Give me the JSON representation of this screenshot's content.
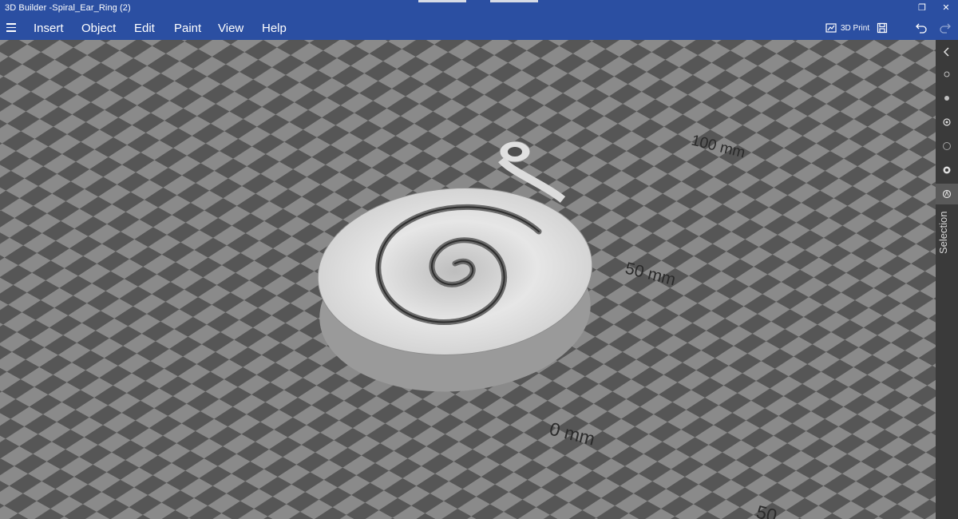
{
  "window": {
    "title": "3D Builder -Spiral_Ear_Ring (2)",
    "restore_glyph": "❐",
    "close_glyph": "✕"
  },
  "menu": {
    "items": [
      "Insert",
      "Object",
      "Edit",
      "Paint",
      "View",
      "Help"
    ]
  },
  "toolbar": {
    "print_label": "3D Print",
    "print_icon": "3d-print-icon",
    "save_icon": "save-icon",
    "undo_icon": "undo-icon",
    "redo_icon": "redo-icon"
  },
  "viewport": {
    "ruler_labels": [
      "100 mm",
      "50 mm",
      "0 mm",
      "50"
    ],
    "model_name": "Spiral_Ear_Ring"
  },
  "sidebar": {
    "label": "Selection",
    "buttons": [
      "collapse-icon",
      "select-icon-1",
      "select-icon-2",
      "select-icon-3",
      "select-icon-4",
      "select-icon-5",
      "selection-mode-icon"
    ]
  },
  "colors": {
    "accent": "#2b4fa2",
    "grid_light": "#8a8a8a",
    "grid_dark": "#565656",
    "model": "#e8e8e8",
    "panel": "#3a3a3a"
  }
}
